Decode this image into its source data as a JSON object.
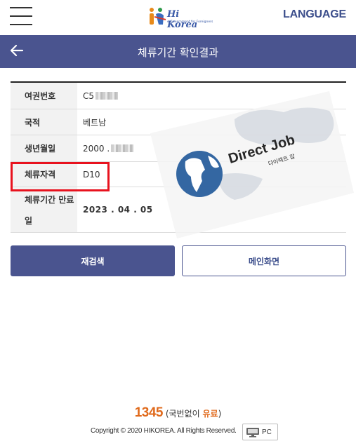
{
  "header": {
    "logo_text": "Hi Korea",
    "logo_sub": "e-Government for Foreigners",
    "language_label": "LANGUAGE"
  },
  "titlebar": {
    "title": "체류기간 확인결과"
  },
  "info": [
    {
      "label": "여권번호",
      "value": "C5"
    },
    {
      "label": "국적",
      "value": "베트남"
    },
    {
      "label": "생년월일",
      "value": "2000 ."
    },
    {
      "label": "체류자격",
      "value": "D10"
    },
    {
      "label": "체류기간 만료일",
      "value": "2023 . 04 . 05"
    }
  ],
  "watermark": {
    "text": "Direct Job",
    "sub": "다이렉트 잡"
  },
  "buttons": {
    "research": "재검색",
    "main": "메인화면"
  },
  "footer": {
    "phone_number": "1345",
    "phone_prefix": "(국번없이 ",
    "phone_paid": "유료",
    "phone_suffix": ")",
    "copyright": "Copyright © 2020 HIKOREA. All Rights Reserved.",
    "pc_label": "PC"
  },
  "colors": {
    "primary": "#4a548f",
    "highlight": "#e8121e",
    "accent": "#e06a1c"
  }
}
